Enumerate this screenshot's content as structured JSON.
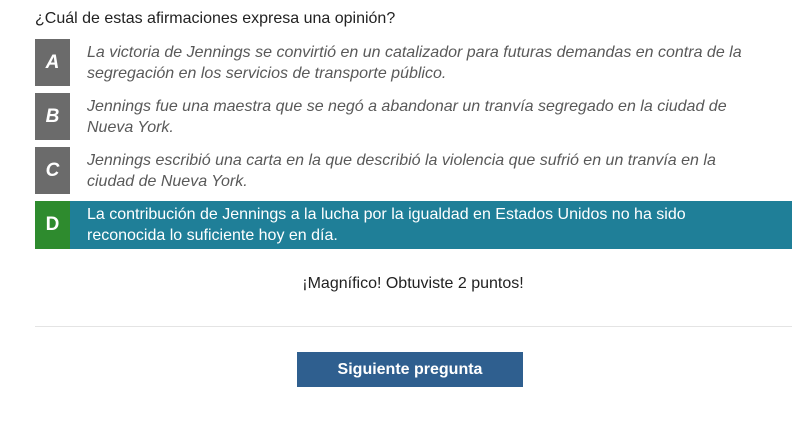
{
  "question": "¿Cuál de estas afirmaciones expresa una opinión?",
  "options": [
    {
      "letter": "A",
      "text": "La victoria de Jennings se convirtió en un catalizador para futuras demandas en contra de la segregación en los servicios de transporte público.",
      "selected": false
    },
    {
      "letter": "B",
      "text": "Jennings fue una maestra que se negó a abandonar un tranvía segregado en la ciudad de Nueva York.",
      "selected": false
    },
    {
      "letter": "C",
      "text": "Jennings escribió una carta en la que describió la violencia que sufrió en un tranvía en la ciudad de Nueva York.",
      "selected": false
    },
    {
      "letter": "D",
      "text": "La contribución de Jennings a la lucha por la igualdad en Estados Unidos no ha sido reconocida lo suficiente hoy en día.",
      "selected": true
    }
  ],
  "feedback": "¡Magnífico! Obtuviste 2 puntos!",
  "next_button": "Siguiente pregunta",
  "colors": {
    "letter_bg": "#6b6b6b",
    "correct_letter_bg": "#2e8b2e",
    "selected_bg": "#1f7f98",
    "button_bg": "#2f5f8f"
  }
}
